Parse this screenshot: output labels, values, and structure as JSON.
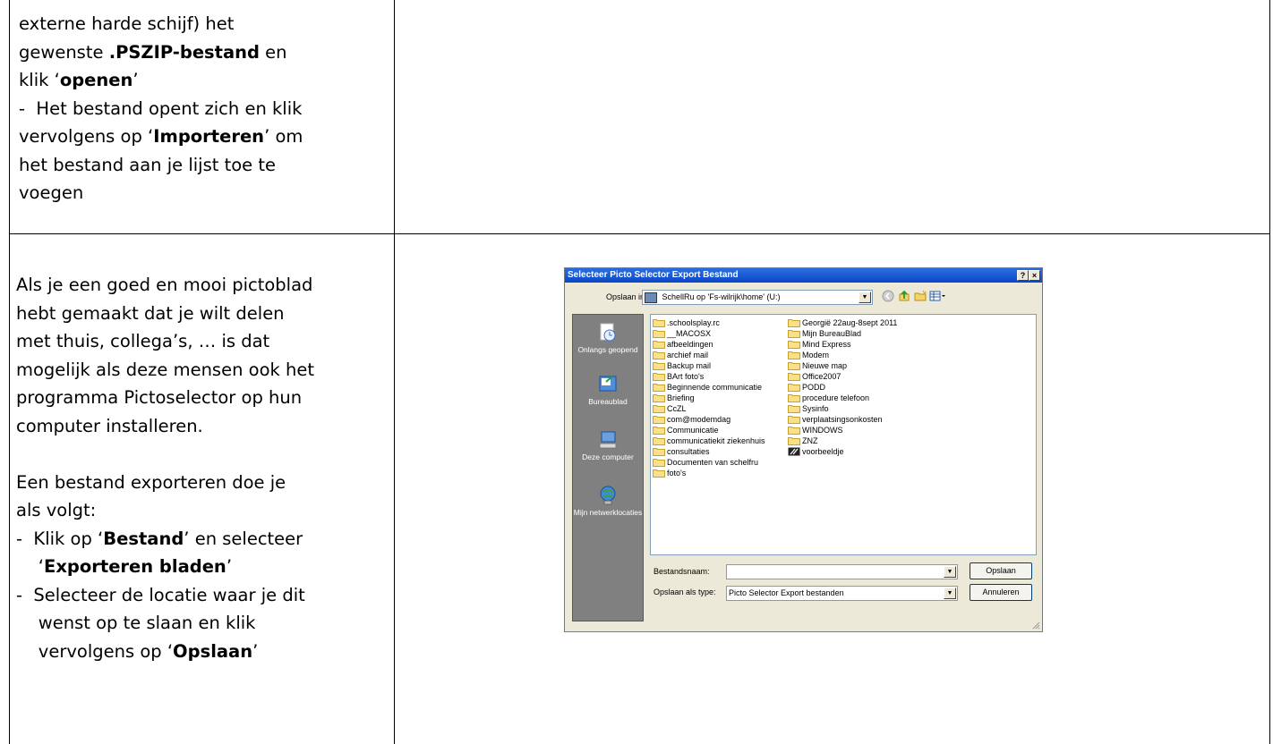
{
  "top_cell": {
    "lines": [
      {
        "parts": [
          {
            "t": "externe harde schijf) het",
            "b": false
          }
        ],
        "bullet": false
      },
      {
        "parts": [
          {
            "t": "gewenste ",
            "b": false
          },
          {
            "t": ".PSZIP-bestand",
            "b": true
          },
          {
            "t": " en",
            "b": false
          }
        ],
        "bullet": false
      },
      {
        "parts": [
          {
            "t": "klik ‘",
            "b": false
          },
          {
            "t": "openen",
            "b": true
          },
          {
            "t": "’",
            "b": false
          }
        ],
        "bullet": false
      },
      {
        "parts": [
          {
            "t": "-  Het bestand opent zich en klik",
            "b": false
          }
        ],
        "bullet": false
      },
      {
        "parts": [
          {
            "t": "vervolgens op ‘",
            "b": false
          },
          {
            "t": "Importeren",
            "b": true
          },
          {
            "t": "’ om",
            "b": false
          }
        ],
        "bullet": false
      },
      {
        "parts": [
          {
            "t": "het bestand aan je lijst toe te",
            "b": false
          }
        ],
        "bullet": false
      },
      {
        "parts": [
          {
            "t": "voegen",
            "b": false
          }
        ],
        "bullet": false
      }
    ]
  },
  "bottom_cell": {
    "lines": [
      {
        "parts": [
          {
            "t": "Als je een goed en mooi pictoblad",
            "b": false
          }
        ]
      },
      {
        "parts": [
          {
            "t": "hebt gemaakt dat je wilt delen",
            "b": false
          }
        ]
      },
      {
        "parts": [
          {
            "t": "met thuis, collega’s, … is dat",
            "b": false
          }
        ]
      },
      {
        "parts": [
          {
            "t": "mogelijk als deze mensen ook het",
            "b": false
          }
        ]
      },
      {
        "parts": [
          {
            "t": "programma Pictoselector op hun",
            "b": false
          }
        ]
      },
      {
        "parts": [
          {
            "t": "computer installeren.",
            "b": false
          }
        ]
      },
      {
        "parts": [
          {
            "t": "",
            "b": false
          }
        ]
      },
      {
        "parts": [
          {
            "t": "Een bestand exporteren doe je",
            "b": false
          }
        ]
      },
      {
        "parts": [
          {
            "t": "als volgt:",
            "b": false
          }
        ]
      },
      {
        "parts": [
          {
            "t": "-  Klik op ‘",
            "b": false
          },
          {
            "t": "Bestand",
            "b": true
          },
          {
            "t": "’ en selecteer",
            "b": false
          }
        ]
      },
      {
        "parts": [
          {
            "t": "    ‘",
            "b": false
          },
          {
            "t": "Exporteren bladen",
            "b": true
          },
          {
            "t": "’",
            "b": false
          }
        ]
      },
      {
        "parts": [
          {
            "t": "-  Selecteer de locatie waar je dit",
            "b": false
          }
        ]
      },
      {
        "parts": [
          {
            "t": "    wenst op te slaan en klik",
            "b": false
          }
        ]
      },
      {
        "parts": [
          {
            "t": "    vervolgens op ‘",
            "b": false
          },
          {
            "t": "Opslaan",
            "b": true
          },
          {
            "t": "’",
            "b": false
          }
        ]
      }
    ]
  },
  "dialog": {
    "title": "Selecteer Picto Selector Export Bestand",
    "help_btn": "?",
    "close_btn": "×",
    "save_in_label": "Opslaan in:",
    "save_in_value": "SchellRu op 'Fs-wilrijk\\home' (U:)",
    "places": [
      "Onlangs geopend",
      "Bureaublad",
      "Deze computer",
      "Mijn netwerklocaties"
    ],
    "files_col1": [
      ".schoolsplay.rc",
      "__MACOSX",
      "afbeeldingen",
      "archief mail",
      "Backup mail",
      "BArt foto's",
      "Beginnende communicatie",
      "Briefing",
      "CcZL",
      "com@modemdag",
      "Communicatie",
      "communicatiekit ziekenhuis",
      "consultaties",
      "Documenten van schelfru",
      "foto's"
    ],
    "files_col2": [
      "Georgië 22aug-8sept 2011",
      "Mijn BureauBlad",
      "Mind Express",
      "Modem",
      "Nieuwe map",
      "Office2007",
      "PODD",
      "procedure telefoon",
      "Sysinfo",
      "verplaatsingsonkosten",
      "WINDOWS",
      "ZNZ",
      "voorbeeldje"
    ],
    "filename_label": "Bestandsnaam:",
    "filename_value": "",
    "type_label": "Opslaan als type:",
    "type_value": "Picto Selector Export bestanden",
    "save_button": "Opslaan",
    "cancel_button": "Annuleren"
  }
}
